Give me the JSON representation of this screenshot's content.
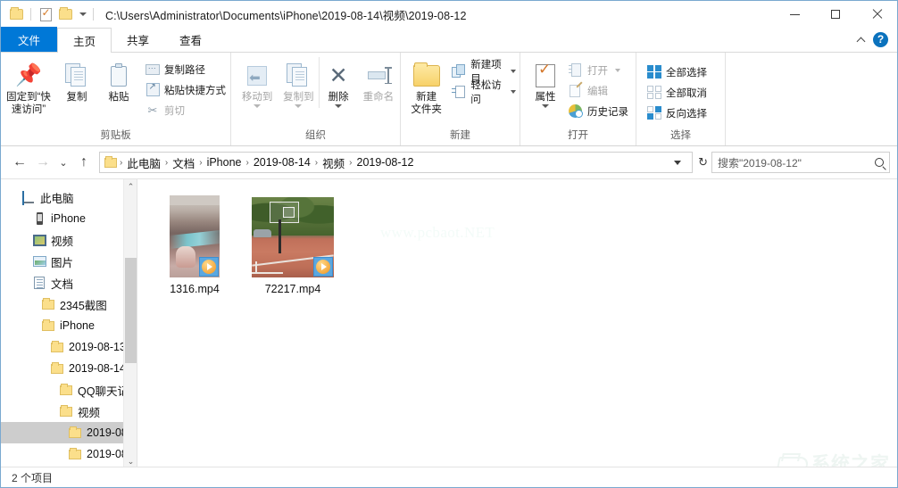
{
  "window": {
    "title_path": "C:\\Users\\Administrator\\Documents\\iPhone\\2019-08-14\\视频\\2019-08-12",
    "minimize_label": "最小化",
    "maximize_label": "最大化",
    "close_label": "关闭"
  },
  "quick_access": {
    "items": [
      {
        "name": "folder-icon",
        "label": "属性"
      },
      {
        "name": "properties-icon",
        "label": "属性"
      },
      {
        "name": "new-folder-icon",
        "label": "新建文件夹"
      }
    ],
    "customize_label": "自定义快速访问工具栏"
  },
  "tabs": [
    {
      "id": "file",
      "label": "文件",
      "active": false,
      "is_file_menu": true
    },
    {
      "id": "home",
      "label": "主页",
      "active": true,
      "is_file_menu": false
    },
    {
      "id": "share",
      "label": "共享",
      "active": false,
      "is_file_menu": false
    },
    {
      "id": "view",
      "label": "查看",
      "active": false,
      "is_file_menu": false
    }
  ],
  "ribbon_right": {
    "collapse_icon": "chevron-up-icon",
    "help_icon": "help-icon",
    "help_label": "?"
  },
  "ribbon": {
    "groups": [
      {
        "id": "clipboard",
        "label": "剪贴板",
        "big_buttons": [
          {
            "id": "pin-to-quick-access",
            "label": "固定到“快\n速访问”",
            "line1": "固定到“快",
            "line2": "速访问”",
            "icon": "pin-icon",
            "disabled": false
          },
          {
            "id": "copy",
            "label": "复制",
            "icon": "copy-icon",
            "disabled": false
          },
          {
            "id": "paste",
            "label": "粘贴",
            "icon": "paste-icon",
            "disabled": false
          }
        ],
        "small_buttons": [
          {
            "id": "copy-path",
            "label": "复制路径",
            "icon": "copy-path-icon",
            "disabled": false
          },
          {
            "id": "paste-shortcut",
            "label": "粘贴快捷方式",
            "icon": "paste-shortcut-icon",
            "disabled": false
          },
          {
            "id": "cut",
            "label": "剪切",
            "icon": "scissors-icon",
            "disabled": true
          }
        ]
      },
      {
        "id": "organize",
        "label": "组织",
        "big_buttons": [
          {
            "id": "move-to",
            "label": "移动到",
            "icon": "move-to-icon",
            "disabled": true,
            "has_caret": true
          },
          {
            "id": "copy-to",
            "label": "复制到",
            "icon": "copy-to-icon",
            "disabled": true,
            "has_caret": true
          },
          {
            "id": "delete",
            "label": "删除",
            "icon": "delete-icon",
            "disabled": false,
            "has_caret": true
          },
          {
            "id": "rename",
            "label": "重命名",
            "icon": "rename-icon",
            "disabled": true,
            "has_caret": false
          }
        ]
      },
      {
        "id": "new",
        "label": "新建",
        "big_buttons": [
          {
            "id": "new-folder",
            "line1": "新建",
            "line2": "文件夹",
            "label": "新建文件夹",
            "icon": "new-folder-icon",
            "disabled": false
          }
        ],
        "small_buttons": [
          {
            "id": "new-item",
            "label": "新建项目",
            "icon": "new-item-icon",
            "disabled": false,
            "has_caret": true
          },
          {
            "id": "easy-access",
            "label": "轻松访问",
            "icon": "easy-access-icon",
            "disabled": false,
            "has_caret": true
          }
        ]
      },
      {
        "id": "open",
        "label": "打开",
        "big_buttons": [
          {
            "id": "properties",
            "label": "属性",
            "icon": "properties-icon",
            "disabled": false,
            "has_caret": true
          }
        ],
        "small_buttons": [
          {
            "id": "open",
            "label": "打开",
            "icon": "open-icon",
            "disabled": true,
            "has_caret": true
          },
          {
            "id": "edit",
            "label": "编辑",
            "icon": "edit-icon",
            "disabled": true
          },
          {
            "id": "history",
            "label": "历史记录",
            "icon": "history-icon",
            "disabled": false
          }
        ]
      },
      {
        "id": "select",
        "label": "选择",
        "small_buttons": [
          {
            "id": "select-all",
            "label": "全部选择",
            "icon": "select-all-icon",
            "disabled": false
          },
          {
            "id": "select-none",
            "label": "全部取消",
            "icon": "select-none-icon",
            "disabled": false
          },
          {
            "id": "invert-selection",
            "label": "反向选择",
            "icon": "invert-selection-icon",
            "disabled": false
          }
        ]
      }
    ]
  },
  "navigation": {
    "back_label": "←",
    "forward_label": "→",
    "recent_label": "⌄",
    "up_label": "↑",
    "back_enabled": true,
    "forward_enabled": false,
    "refresh_label": "↻"
  },
  "breadcrumb": {
    "crumbs": [
      "此电脑",
      "文档",
      "iPhone",
      "2019-08-14",
      "视频",
      "2019-08-12"
    ],
    "separator": "›"
  },
  "search": {
    "placeholder": "搜索\"2019-08-12\"",
    "value": "搜索\"2019-08-12\"",
    "icon": "search-icon"
  },
  "sidebar": {
    "items": [
      {
        "label": "此电脑",
        "icon": "computer-icon",
        "indent": 0,
        "selected": false
      },
      {
        "label": "iPhone",
        "icon": "phone-icon",
        "indent": 1,
        "selected": false
      },
      {
        "label": "视频",
        "icon": "video-icon",
        "indent": 1,
        "selected": false
      },
      {
        "label": "图片",
        "icon": "picture-icon",
        "indent": 1,
        "selected": false
      },
      {
        "label": "文档",
        "icon": "document-icon",
        "indent": 1,
        "selected": false
      },
      {
        "label": "2345截图",
        "icon": "folder-icon",
        "indent": 2,
        "selected": false
      },
      {
        "label": "iPhone",
        "icon": "folder-icon",
        "indent": 2,
        "selected": false
      },
      {
        "label": "2019-08-13",
        "icon": "folder-icon",
        "indent": 3,
        "selected": false
      },
      {
        "label": "2019-08-14",
        "icon": "folder-icon",
        "indent": 3,
        "selected": false
      },
      {
        "label": "QQ聊天记录",
        "icon": "folder-icon",
        "indent": 4,
        "selected": false
      },
      {
        "label": "视频",
        "icon": "folder-icon",
        "indent": 4,
        "selected": false
      },
      {
        "label": "2019-08-",
        "icon": "folder-icon",
        "indent": 5,
        "selected": true
      },
      {
        "label": "2019-08-",
        "icon": "folder-icon",
        "indent": 5,
        "selected": false
      }
    ],
    "scroll_up_label": "⌃",
    "scroll_down_label": "⌄"
  },
  "files": [
    {
      "name": "1316.mp4",
      "type": "video",
      "thumb": "portrait-group-photo",
      "badge": "play-badge"
    },
    {
      "name": "72217.mp4",
      "type": "video",
      "thumb": "basketball-court",
      "badge": "play-badge"
    }
  ],
  "statusbar": {
    "item_count_text": "2 个项目"
  },
  "watermarks": {
    "center": "www.pcbaot.NET",
    "corner": "系统之家"
  }
}
